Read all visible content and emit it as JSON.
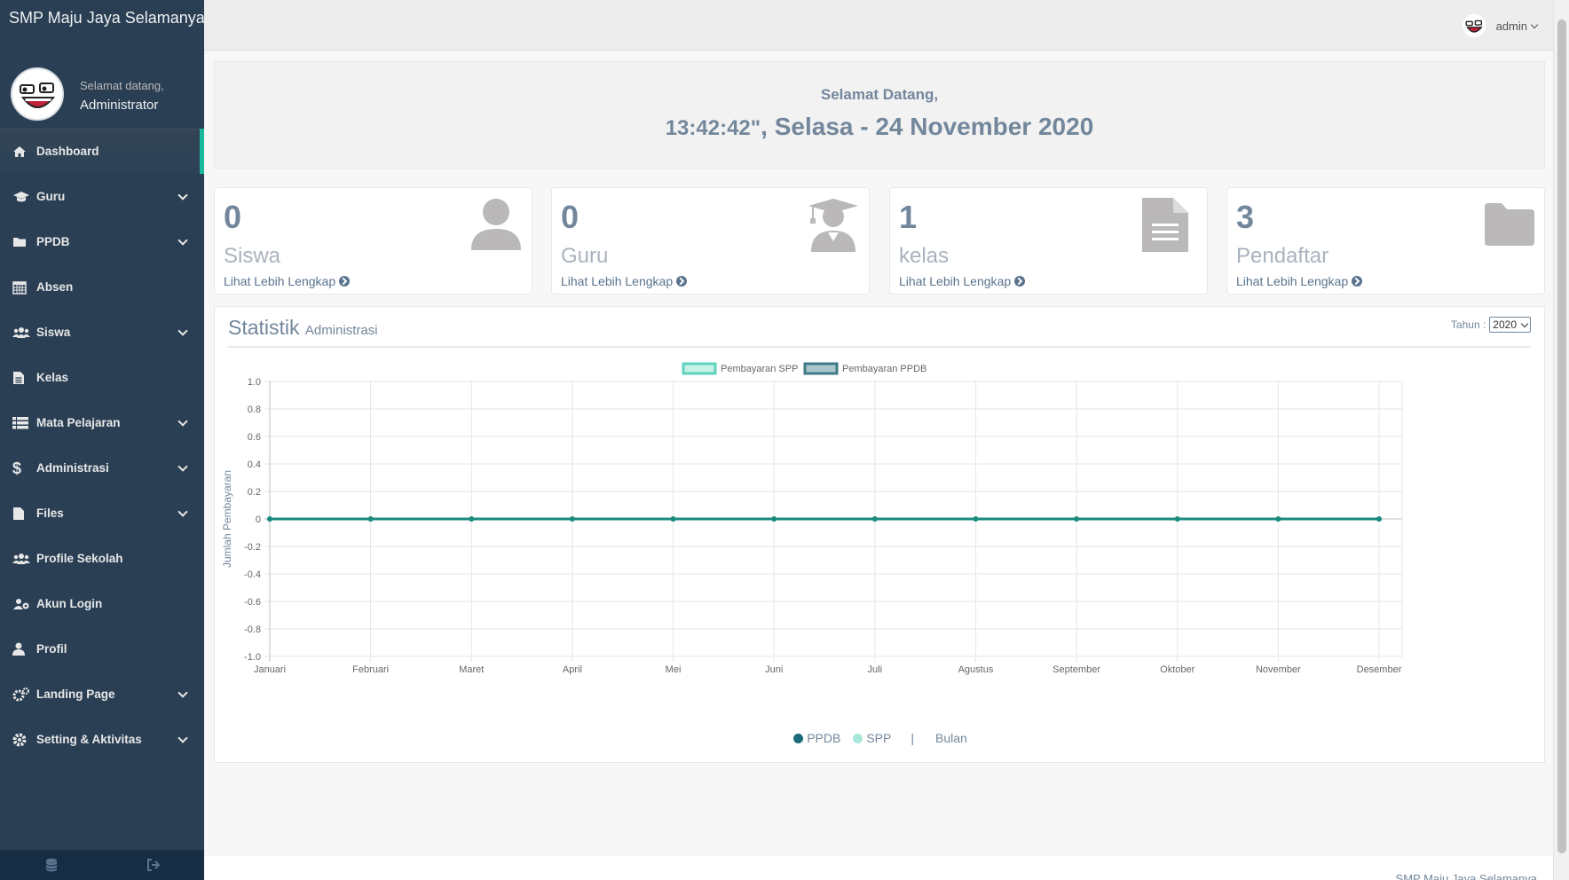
{
  "sidebar": {
    "brand": "SMP Maju Jaya Selamanya",
    "profile": {
      "greeting": "Selamat datang,",
      "name": "Administrator"
    },
    "items": [
      {
        "label": "Dashboard",
        "icon": "home-icon",
        "active": true,
        "has_submenu": false
      },
      {
        "label": "Guru",
        "icon": "graduation-cap-icon",
        "active": false,
        "has_submenu": true
      },
      {
        "label": "PPDB",
        "icon": "folder-icon",
        "active": false,
        "has_submenu": true
      },
      {
        "label": "Absen",
        "icon": "calendar-icon",
        "active": false,
        "has_submenu": false
      },
      {
        "label": "Siswa",
        "icon": "users-icon",
        "active": false,
        "has_submenu": true
      },
      {
        "label": "Kelas",
        "icon": "file-text-icon",
        "active": false,
        "has_submenu": false
      },
      {
        "label": "Mata Pelajaran",
        "icon": "list-icon",
        "active": false,
        "has_submenu": true
      },
      {
        "label": "Administrasi",
        "icon": "dollar-icon",
        "active": false,
        "has_submenu": true
      },
      {
        "label": "Files",
        "icon": "file-icon",
        "active": false,
        "has_submenu": true
      },
      {
        "label": "Profile Sekolah",
        "icon": "users-icon",
        "active": false,
        "has_submenu": false
      },
      {
        "label": "Akun Login",
        "icon": "users-cog-icon",
        "active": false,
        "has_submenu": false
      },
      {
        "label": "Profil",
        "icon": "user-icon",
        "active": false,
        "has_submenu": false
      },
      {
        "label": "Landing Page",
        "icon": "cogs-icon",
        "active": false,
        "has_submenu": true
      },
      {
        "label": "Setting & Aktivitas",
        "icon": "gear-icon",
        "active": false,
        "has_submenu": true
      }
    ],
    "footer_icons": [
      "database-icon",
      "sign-out-icon"
    ]
  },
  "topnav": {
    "user": "admin"
  },
  "welcome": {
    "greeting": "Selamat Datang,",
    "time": "13:42:42\"",
    "date": ", Selasa - 24 November 2020"
  },
  "tiles": [
    {
      "count": "0",
      "label": "Siswa",
      "link": "Lihat Lebih Lengkap",
      "icon": "user-icon"
    },
    {
      "count": "0",
      "label": "Guru",
      "link": "Lihat Lebih Lengkap",
      "icon": "user-graduate-icon"
    },
    {
      "count": "1",
      "label": "kelas",
      "link": "Lihat Lebih Lengkap",
      "icon": "file-text-icon"
    },
    {
      "count": "3",
      "label": "Pendaftar",
      "link": "Lihat Lebih Lengkap",
      "icon": "folder-icon"
    }
  ],
  "statistik": {
    "title": "Statistik",
    "subtitle": "Administrasi",
    "year_label": "Tahun :",
    "year_value": "2020",
    "legend_bottom": {
      "ppdb": "PPDB",
      "spp": "SPP",
      "separator": "|",
      "axis": "Bulan"
    }
  },
  "chart_data": {
    "type": "line",
    "title": "",
    "xlabel": "",
    "ylabel": "Jumlah Pembayaran",
    "categories": [
      "Januari",
      "Februari",
      "Maret",
      "April",
      "Mei",
      "Juni",
      "Juli",
      "Agustus",
      "September",
      "Oktober",
      "November",
      "Desember"
    ],
    "ylim": [
      -1.0,
      1.0
    ],
    "yticks": [
      "1.0",
      "0.8",
      "0.6",
      "0.4",
      "0.2",
      "0",
      "-0.2",
      "-0.4",
      "-0.6",
      "-0.8",
      "-1.0"
    ],
    "grid": true,
    "legend": "top-center",
    "series": [
      {
        "name": "Pembayaran SPP",
        "values": [
          0,
          0,
          0,
          0,
          0,
          0,
          0,
          0,
          0,
          0,
          0,
          0
        ],
        "color": "#a6e7d9"
      },
      {
        "name": "Pembayaran PPDB",
        "values": [
          0,
          0,
          0,
          0,
          0,
          0,
          0,
          0,
          0,
          0,
          0,
          0
        ],
        "color": "#1b6b79"
      }
    ]
  },
  "footer": {
    "text": "SMP Maju Jaya Selamanya"
  },
  "colors": {
    "sidebar": "#2a3f54",
    "accent": "#1abb9c",
    "text": "#73879c",
    "ppdb": "#1b6b79",
    "spp": "#a6e7d9"
  }
}
